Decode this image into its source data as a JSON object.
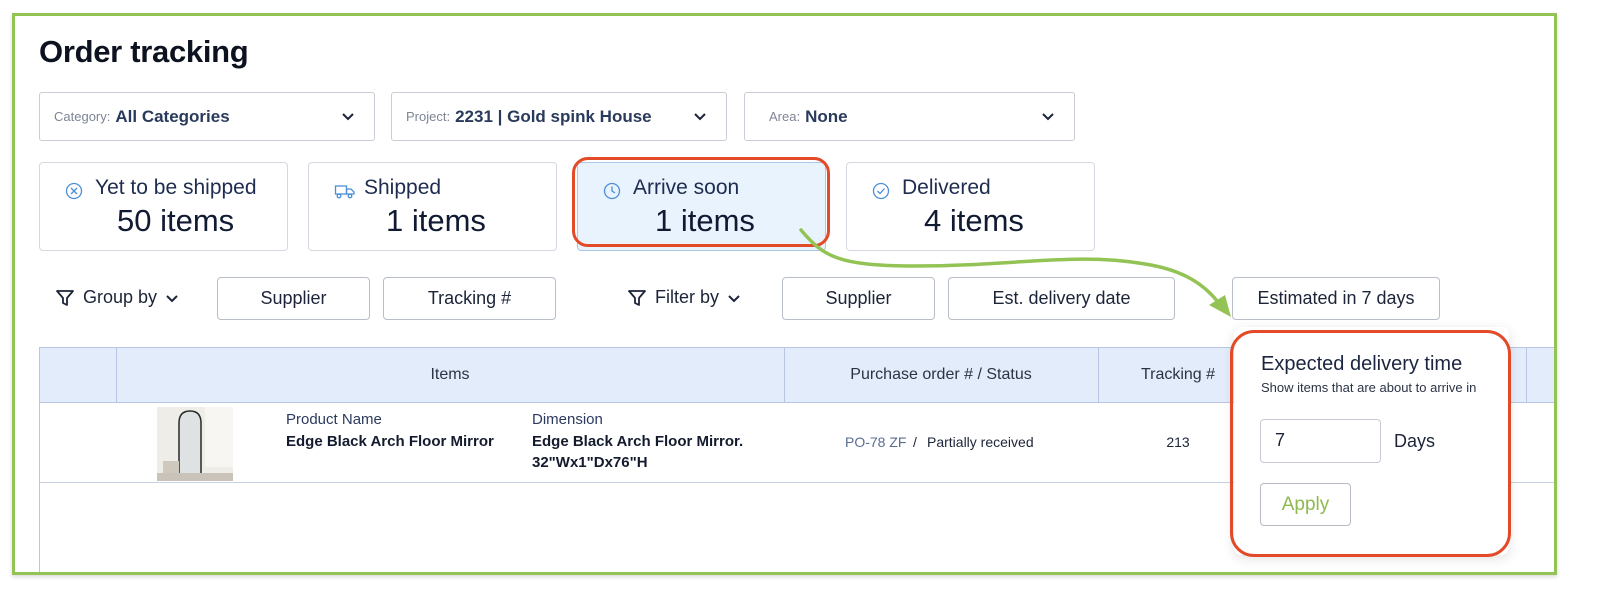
{
  "page": {
    "title": "Order tracking"
  },
  "filters": {
    "category": {
      "label": "Category:",
      "value": "All Categories"
    },
    "project": {
      "label": "Project:",
      "value": "2231 | Gold spink House"
    },
    "area": {
      "label": "Area:",
      "value": "None"
    }
  },
  "status_cards": [
    {
      "title": "Yet to be shipped",
      "count": "50 items",
      "icon": "x-circle-icon"
    },
    {
      "title": "Shipped",
      "count": "1 items",
      "icon": "truck-icon"
    },
    {
      "title": "Arrive soon",
      "count": "1 items",
      "icon": "clock-icon",
      "selected": true
    },
    {
      "title": "Delivered",
      "count": "4 items",
      "icon": "check-circle-icon"
    }
  ],
  "toolbar": {
    "group_by_label": "Group by",
    "group_by_options": [
      "Supplier",
      "Tracking #"
    ],
    "filter_by_label": "Filter by",
    "filter_by_options": [
      "Supplier",
      "Est. delivery date",
      "Estimated in 7 days"
    ]
  },
  "table": {
    "headers": {
      "items": "Items",
      "po_status": "Purchase order # / Status",
      "tracking": "Tracking #"
    },
    "rows": [
      {
        "product_name_label": "Product Name",
        "product_name": "Edge Black Arch Floor Mirror",
        "dimension_label": "Dimension",
        "dimension_line1": "Edge Black Arch Floor Mirror.",
        "dimension_line2": "32\"Wx1\"Dx76\"H",
        "po_number": "PO-78 ZF",
        "separator": "/",
        "status": "Partially received",
        "tracking": "213"
      }
    ]
  },
  "popover": {
    "title": "Expected delivery time",
    "subtitle": "Show items that are about to arrive in",
    "input_value": "7",
    "unit": "Days",
    "apply_label": "Apply"
  },
  "colors": {
    "frame": "#93c354",
    "highlight": "#e34a28",
    "arrow": "#93c354",
    "selected_card": "#e8f3fd",
    "header_bg": "#e3ecfb"
  }
}
